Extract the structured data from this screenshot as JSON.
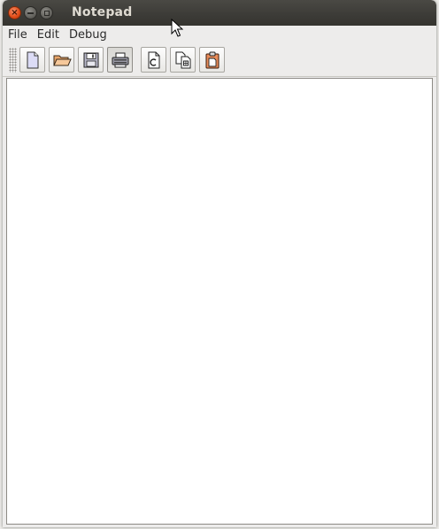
{
  "window": {
    "title": "Notepad",
    "controls": {
      "close_glyph": "×",
      "minimize_icon": "minimize-icon",
      "maximize_icon": "maximize-icon"
    }
  },
  "menubar": {
    "items": [
      {
        "label": "File"
      },
      {
        "label": "Edit"
      },
      {
        "label": "Debug"
      }
    ]
  },
  "toolbar": {
    "buttons": [
      {
        "icon": "new-file-icon",
        "pressed": false
      },
      {
        "icon": "open-folder-icon",
        "pressed": false
      },
      {
        "icon": "save-disk-icon",
        "pressed": false
      },
      {
        "icon": "print-icon",
        "pressed": true
      },
      {
        "icon": "cut-icon",
        "pressed": false
      },
      {
        "icon": "copy-icon",
        "pressed": false
      },
      {
        "icon": "paste-icon",
        "pressed": false
      }
    ]
  },
  "editor": {
    "content": ""
  },
  "colors": {
    "titlebar": "#3c3b37",
    "title_text": "#dfdbd2",
    "close_button": "#df4a16",
    "window_bg": "#edeceb",
    "editor_bg": "#ffffff"
  }
}
